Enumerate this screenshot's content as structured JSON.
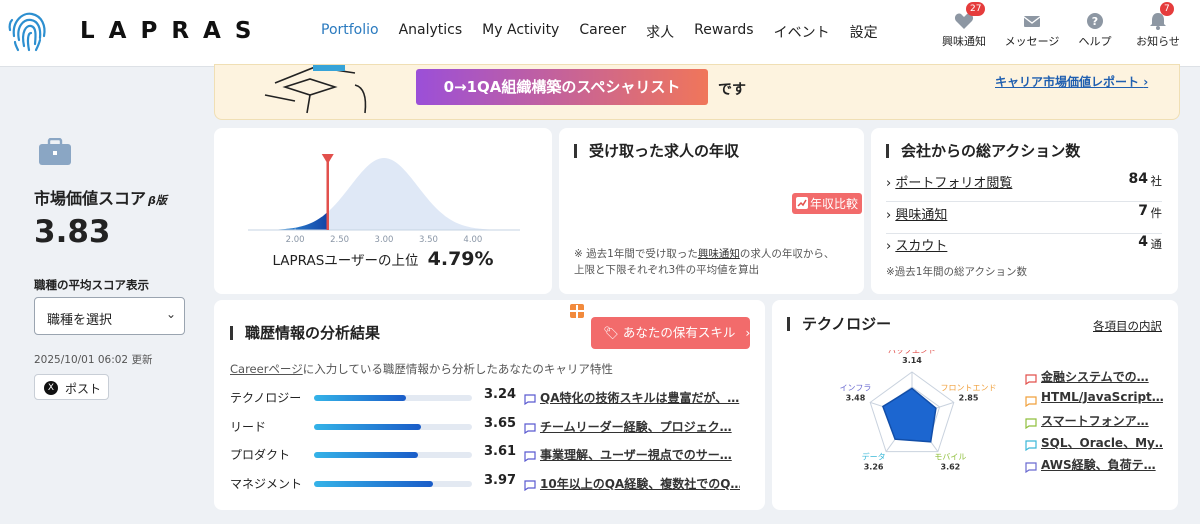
{
  "header": {
    "logo_text": "LAPRAS",
    "nav": [
      "Portfolio",
      "Analytics",
      "My Activity",
      "Career",
      "求人",
      "Rewards",
      "イベント",
      "設定"
    ],
    "icons": [
      {
        "label": "興味通知",
        "icon": "heart-icon",
        "badge": "27"
      },
      {
        "label": "メッセージ",
        "icon": "mail-icon",
        "badge": ""
      },
      {
        "label": "ヘルプ",
        "icon": "help-icon",
        "badge": ""
      },
      {
        "label": "お知らせ",
        "icon": "bell-icon",
        "badge": "7"
      }
    ]
  },
  "banner": {
    "button_label": "0→1QA組織構築のスペシャリスト",
    "suffix": "です",
    "report_link": "キャリア市場価値レポート"
  },
  "sidebar": {
    "title": "市場価値スコア",
    "beta": "β版",
    "score": "3.83",
    "avg_label": "職種の平均スコア表示",
    "select_value": "職種を選択",
    "updated": "2025/10/01 06:02 更新",
    "post_label": "ポスト"
  },
  "distribution": {
    "ticks": [
      "2.00",
      "2.50",
      "3.00",
      "3.50",
      "4.00"
    ],
    "caption_prefix": "LAPRASユーザーの上位",
    "percent": "4.79%"
  },
  "salary": {
    "title": "受け取った求人の年収",
    "compare_button": "年収比較",
    "note_line1_a": "※ 過去1年間で受け取った",
    "note_line1_link": "興味通知",
    "note_line1_b": "の求人の年収から、",
    "note_line2": "上限と下限それぞれ3件の平均値を算出"
  },
  "actions": {
    "title": "会社からの総アクション数",
    "rows": [
      {
        "label": "ポートフォリオ閲覧",
        "value": "84",
        "unit": "社"
      },
      {
        "label": "興味通知",
        "value": "7",
        "unit": "件"
      },
      {
        "label": "スカウト",
        "value": "4",
        "unit": "通"
      }
    ],
    "note": "※過去1年間の総アクション数"
  },
  "career": {
    "title": "職歴情報の分析結果",
    "skills_button": "あなたの保有スキル",
    "desc_link": "Careerページ",
    "desc_rest": "に入力している職歴情報から分析したあなたのキャリア特性",
    "rows": [
      {
        "label": "テクノロジー",
        "score": "3.24",
        "fill": 0.58,
        "comment": "QA特化の技術スキルは豊富だが、…"
      },
      {
        "label": "リード",
        "score": "3.65",
        "fill": 0.68,
        "comment": "チームリーダー経験、プロジェク…"
      },
      {
        "label": "プロダクト",
        "score": "3.61",
        "fill": 0.66,
        "comment": "事業理解、ユーザー視点でのサー…"
      },
      {
        "label": "マネジメント",
        "score": "3.97",
        "fill": 0.75,
        "comment": "10年以上のQA経験、複数社でのQ…"
      }
    ]
  },
  "technology": {
    "title": "テクノロジー",
    "detail_link": "各項目の内訳",
    "radar": [
      {
        "label": "バックエンド",
        "value": "3.14",
        "color": "#e2504c"
      },
      {
        "label": "フロントエンド",
        "value": "2.85",
        "color": "#f0a03c"
      },
      {
        "label": "モバイル",
        "value": "3.62",
        "color": "#8fbf3c"
      },
      {
        "label": "データ",
        "value": "3.26",
        "color": "#3cb8d8"
      },
      {
        "label": "インフラ",
        "value": "3.48",
        "color": "#6a6ad0"
      }
    ],
    "items": [
      {
        "text": "金融システムでの…",
        "color": "#e2504c"
      },
      {
        "text": "HTML/JavaScript…",
        "color": "#f0a03c"
      },
      {
        "text": "スマートフォンア…",
        "color": "#8fbf3c"
      },
      {
        "text": "SQL、Oracle、My…",
        "color": "#3cb8d8"
      },
      {
        "text": "AWS経験、負荷テ…",
        "color": "#6a6ad0"
      }
    ]
  }
}
